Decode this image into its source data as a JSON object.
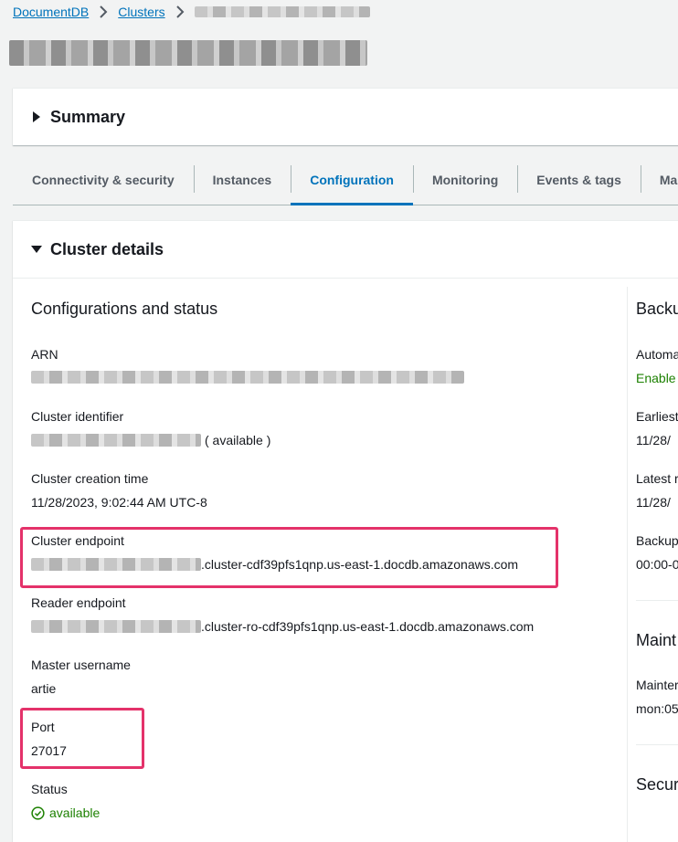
{
  "breadcrumb": {
    "items": [
      "DocumentDB",
      "Clusters"
    ]
  },
  "summary": {
    "title": "Summary"
  },
  "tabs": [
    "Connectivity & security",
    "Instances",
    "Configuration",
    "Monitoring",
    "Events & tags",
    "Main"
  ],
  "active_tab": "Configuration",
  "details": {
    "title": "Cluster details",
    "section_title": "Configurations and status",
    "arn_label": "ARN",
    "cluster_identifier_label": "Cluster identifier",
    "cluster_identifier_suffix": "( available )",
    "creation_time_label": "Cluster creation time",
    "creation_time_value": "11/28/2023, 9:02:44 AM UTC-8",
    "cluster_endpoint_label": "Cluster endpoint",
    "cluster_endpoint_value": ".cluster-cdf39pfs1qnp.us-east-1.docdb.amazonaws.com",
    "reader_endpoint_label": "Reader endpoint",
    "reader_endpoint_value": ".cluster-ro-cdf39pfs1qnp.us-east-1.docdb.amazonaws.com",
    "master_username_label": "Master username",
    "master_username_value": "artie",
    "port_label": "Port",
    "port_value": "27017",
    "status_label": "Status",
    "status_value": "available"
  },
  "right_column": {
    "backup_title": "Backu",
    "automated_label": "Automa",
    "automated_value": "Enable",
    "earliest_label": "Earliest",
    "earliest_value": "11/28/",
    "latest_label": "Latest r",
    "latest_value": "11/28/",
    "backup_window_label": "Backup",
    "backup_window_value": "00:00-0",
    "maintenance_title": "Maint",
    "maintenance_label": "Mainter",
    "maintenance_value": "mon:05",
    "security_title": "Secur"
  },
  "colors": {
    "link": "#0073bb",
    "highlight": "#e4326a",
    "success": "#1d8102"
  }
}
